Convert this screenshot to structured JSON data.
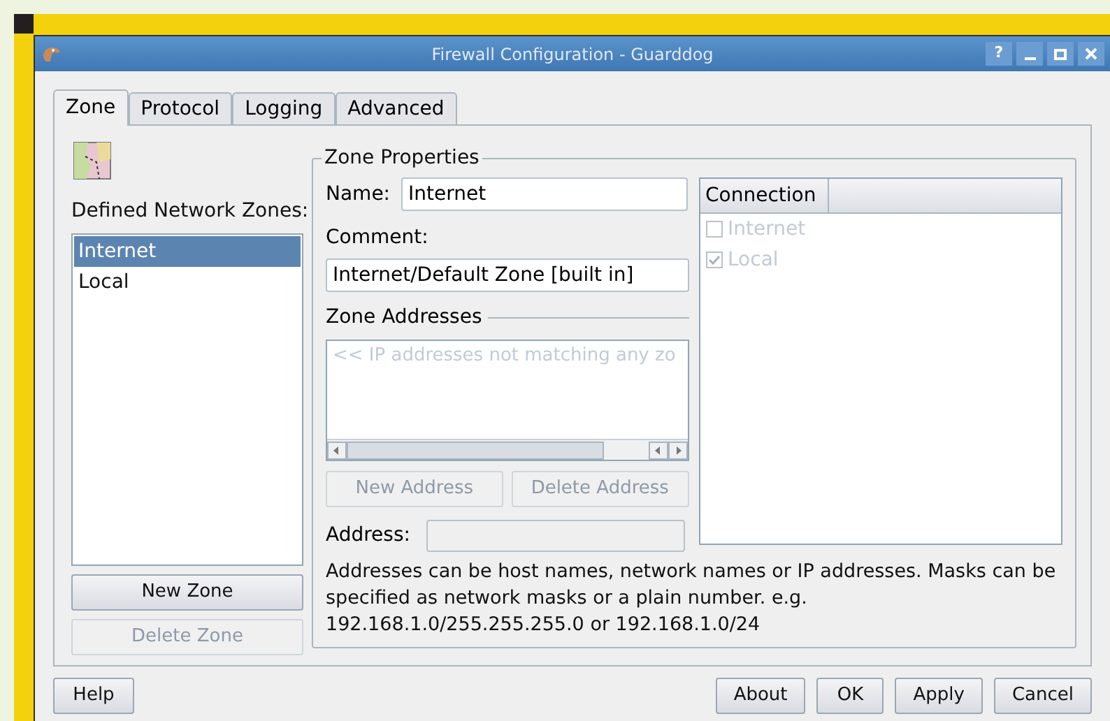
{
  "window": {
    "title": "Firewall Configuration - Guarddog",
    "controls": [
      "?"
    ]
  },
  "tabs": [
    {
      "label": "Zone",
      "selected": true
    },
    {
      "label": "Protocol",
      "selected": false
    },
    {
      "label": "Logging",
      "selected": false
    },
    {
      "label": "Advanced",
      "selected": false
    }
  ],
  "zones": {
    "label": "Defined Network Zones:",
    "items": [
      {
        "label": "Internet",
        "selected": true
      },
      {
        "label": "Local",
        "selected": false
      }
    ],
    "buttons": [
      {
        "label": "New Zone",
        "disabled": false
      },
      {
        "label": "Delete Zone",
        "disabled": true
      }
    ]
  },
  "zone_properties": {
    "title": "Zone Properties",
    "name_label": "Name:",
    "name_value": "Internet",
    "comment_label": "Comment:",
    "comment_value": "Internet/Default Zone [built in]",
    "addresses_title": "Zone Addresses",
    "addresses": [
      "<< IP addresses not matching any zo"
    ],
    "address_buttons": [
      {
        "label": "New Address",
        "disabled": true
      },
      {
        "label": "Delete Address",
        "disabled": true
      }
    ],
    "address_label": "Address:",
    "help": "Addresses can be host names, network names or IP addresses. Masks can be specified as network masks or a plain number. e.g. 192.168.1.0/255.255.255.0 or 192.168.1.0/24"
  },
  "connection": {
    "column": "Connection",
    "items": [
      {
        "label": "Internet",
        "checked": false
      },
      {
        "label": "Local",
        "checked": true
      }
    ]
  },
  "footer": {
    "left": [
      {
        "label": "Help"
      }
    ],
    "right": [
      {
        "label": "About"
      },
      {
        "label": "OK"
      },
      {
        "label": "Apply"
      },
      {
        "label": "Cancel"
      }
    ]
  }
}
